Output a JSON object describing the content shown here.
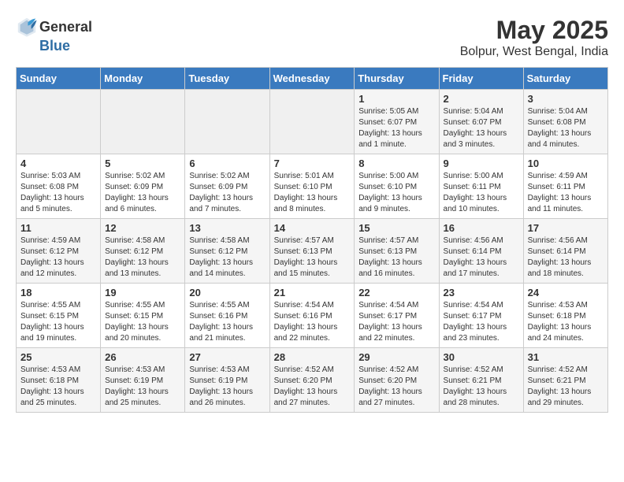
{
  "header": {
    "logo_general": "General",
    "logo_blue": "Blue",
    "main_title": "May 2025",
    "subtitle": "Bolpur, West Bengal, India"
  },
  "days_of_week": [
    "Sunday",
    "Monday",
    "Tuesday",
    "Wednesday",
    "Thursday",
    "Friday",
    "Saturday"
  ],
  "weeks": [
    [
      {
        "day": "",
        "sunrise": "",
        "sunset": "",
        "daylight": ""
      },
      {
        "day": "",
        "sunrise": "",
        "sunset": "",
        "daylight": ""
      },
      {
        "day": "",
        "sunrise": "",
        "sunset": "",
        "daylight": ""
      },
      {
        "day": "",
        "sunrise": "",
        "sunset": "",
        "daylight": ""
      },
      {
        "day": "1",
        "sunrise": "5:05 AM",
        "sunset": "6:07 PM",
        "daylight": "13 hours and 1 minute."
      },
      {
        "day": "2",
        "sunrise": "5:04 AM",
        "sunset": "6:07 PM",
        "daylight": "13 hours and 3 minutes."
      },
      {
        "day": "3",
        "sunrise": "5:04 AM",
        "sunset": "6:08 PM",
        "daylight": "13 hours and 4 minutes."
      }
    ],
    [
      {
        "day": "4",
        "sunrise": "5:03 AM",
        "sunset": "6:08 PM",
        "daylight": "13 hours and 5 minutes."
      },
      {
        "day": "5",
        "sunrise": "5:02 AM",
        "sunset": "6:09 PM",
        "daylight": "13 hours and 6 minutes."
      },
      {
        "day": "6",
        "sunrise": "5:02 AM",
        "sunset": "6:09 PM",
        "daylight": "13 hours and 7 minutes."
      },
      {
        "day": "7",
        "sunrise": "5:01 AM",
        "sunset": "6:10 PM",
        "daylight": "13 hours and 8 minutes."
      },
      {
        "day": "8",
        "sunrise": "5:00 AM",
        "sunset": "6:10 PM",
        "daylight": "13 hours and 9 minutes."
      },
      {
        "day": "9",
        "sunrise": "5:00 AM",
        "sunset": "6:11 PM",
        "daylight": "13 hours and 10 minutes."
      },
      {
        "day": "10",
        "sunrise": "4:59 AM",
        "sunset": "6:11 PM",
        "daylight": "13 hours and 11 minutes."
      }
    ],
    [
      {
        "day": "11",
        "sunrise": "4:59 AM",
        "sunset": "6:12 PM",
        "daylight": "13 hours and 12 minutes."
      },
      {
        "day": "12",
        "sunrise": "4:58 AM",
        "sunset": "6:12 PM",
        "daylight": "13 hours and 13 minutes."
      },
      {
        "day": "13",
        "sunrise": "4:58 AM",
        "sunset": "6:12 PM",
        "daylight": "13 hours and 14 minutes."
      },
      {
        "day": "14",
        "sunrise": "4:57 AM",
        "sunset": "6:13 PM",
        "daylight": "13 hours and 15 minutes."
      },
      {
        "day": "15",
        "sunrise": "4:57 AM",
        "sunset": "6:13 PM",
        "daylight": "13 hours and 16 minutes."
      },
      {
        "day": "16",
        "sunrise": "4:56 AM",
        "sunset": "6:14 PM",
        "daylight": "13 hours and 17 minutes."
      },
      {
        "day": "17",
        "sunrise": "4:56 AM",
        "sunset": "6:14 PM",
        "daylight": "13 hours and 18 minutes."
      }
    ],
    [
      {
        "day": "18",
        "sunrise": "4:55 AM",
        "sunset": "6:15 PM",
        "daylight": "13 hours and 19 minutes."
      },
      {
        "day": "19",
        "sunrise": "4:55 AM",
        "sunset": "6:15 PM",
        "daylight": "13 hours and 20 minutes."
      },
      {
        "day": "20",
        "sunrise": "4:55 AM",
        "sunset": "6:16 PM",
        "daylight": "13 hours and 21 minutes."
      },
      {
        "day": "21",
        "sunrise": "4:54 AM",
        "sunset": "6:16 PM",
        "daylight": "13 hours and 22 minutes."
      },
      {
        "day": "22",
        "sunrise": "4:54 AM",
        "sunset": "6:17 PM",
        "daylight": "13 hours and 22 minutes."
      },
      {
        "day": "23",
        "sunrise": "4:54 AM",
        "sunset": "6:17 PM",
        "daylight": "13 hours and 23 minutes."
      },
      {
        "day": "24",
        "sunrise": "4:53 AM",
        "sunset": "6:18 PM",
        "daylight": "13 hours and 24 minutes."
      }
    ],
    [
      {
        "day": "25",
        "sunrise": "4:53 AM",
        "sunset": "6:18 PM",
        "daylight": "13 hours and 25 minutes."
      },
      {
        "day": "26",
        "sunrise": "4:53 AM",
        "sunset": "6:19 PM",
        "daylight": "13 hours and 25 minutes."
      },
      {
        "day": "27",
        "sunrise": "4:53 AM",
        "sunset": "6:19 PM",
        "daylight": "13 hours and 26 minutes."
      },
      {
        "day": "28",
        "sunrise": "4:52 AM",
        "sunset": "6:20 PM",
        "daylight": "13 hours and 27 minutes."
      },
      {
        "day": "29",
        "sunrise": "4:52 AM",
        "sunset": "6:20 PM",
        "daylight": "13 hours and 27 minutes."
      },
      {
        "day": "30",
        "sunrise": "4:52 AM",
        "sunset": "6:21 PM",
        "daylight": "13 hours and 28 minutes."
      },
      {
        "day": "31",
        "sunrise": "4:52 AM",
        "sunset": "6:21 PM",
        "daylight": "13 hours and 29 minutes."
      }
    ]
  ]
}
